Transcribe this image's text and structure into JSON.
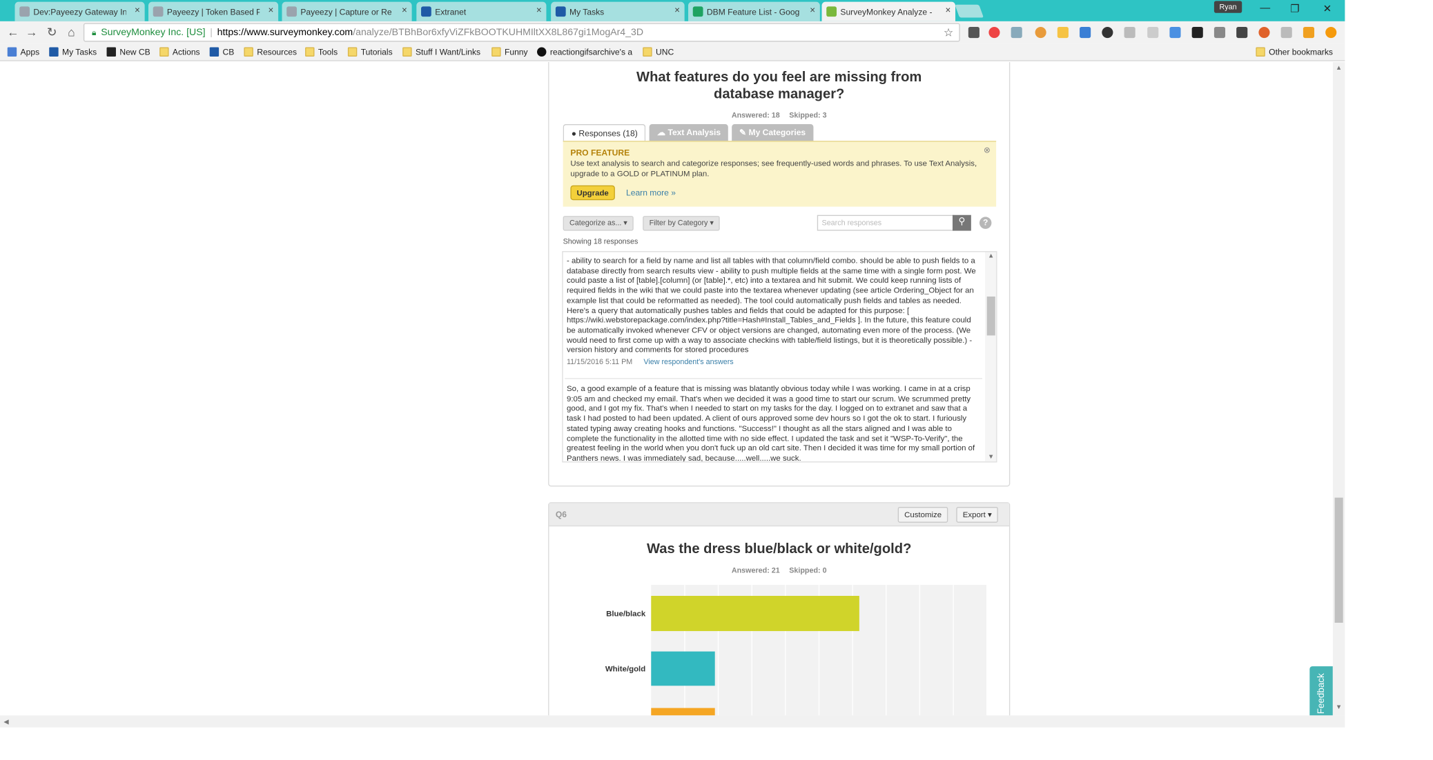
{
  "browser": {
    "tabs": [
      {
        "label": "Dev:Payeezy Gateway Int",
        "favicon_color": "#9aa3ad"
      },
      {
        "label": "Payeezy | Token Based Pa",
        "favicon_color": "#9aa3ad"
      },
      {
        "label": "Payeezy | Capture or Re",
        "favicon_color": "#9aa3ad"
      },
      {
        "label": "Extranet",
        "favicon_color": "#1f5aa6"
      },
      {
        "label": "My Tasks",
        "favicon_color": "#1f5aa6"
      },
      {
        "label": "DBM Feature List - Goog",
        "favicon_color": "#1ea362"
      },
      {
        "label": "SurveyMonkey Analyze -",
        "favicon_color": "#7bb83c"
      }
    ],
    "close_glyph": "×",
    "user_name": "Ryan",
    "window_controls": {
      "minimize": "—",
      "maximize": "❐",
      "close": "✕"
    },
    "nav": {
      "back": "←",
      "forward": "→",
      "reload": "↻",
      "home": "⌂"
    },
    "address": {
      "secure_label": "SurveyMonkey Inc. [US]",
      "url_host": "https://www.surveymonkey.com",
      "url_path": "/analyze/BTBhBor6xfyViZFkBOOTKUHMIltXX8L867gi1MogAr4_3D",
      "star": "☆"
    },
    "bookmarks": [
      {
        "label": "Apps",
        "icon": "apps-grid-icon"
      },
      {
        "label": "My Tasks",
        "icon": "bird-icon"
      },
      {
        "label": "New CB",
        "icon": "cb-icon"
      },
      {
        "label": "Actions",
        "icon": "folder-icon"
      },
      {
        "label": "CB",
        "icon": "bird-icon"
      },
      {
        "label": "Resources",
        "icon": "folder-icon"
      },
      {
        "label": "Tools",
        "icon": "folder-icon"
      },
      {
        "label": "Tutorials",
        "icon": "folder-icon"
      },
      {
        "label": "Stuff I Want/Links",
        "icon": "folder-icon"
      },
      {
        "label": "Funny",
        "icon": "folder-icon"
      },
      {
        "label": "reactiongifsarchive's a",
        "icon": "site-icon"
      },
      {
        "label": "UNC",
        "icon": "folder-icon"
      }
    ],
    "other_bookmarks": "Other bookmarks"
  },
  "q5": {
    "title_line1": "What features do you feel are missing from",
    "title_line2": "database manager?",
    "answered": "Answered: 18",
    "skipped": "Skipped: 3",
    "tabs": {
      "responses": "Responses (18)",
      "text_analysis": "Text Analysis",
      "my_categories": "My Categories"
    },
    "pro": {
      "title": "PRO FEATURE",
      "body": "Use text analysis to search and categorize responses; see frequently-used words and phrases. To use Text Analysis, upgrade to a GOLD or PLATINUM plan.",
      "upgrade": "Upgrade",
      "learn_more": "Learn more »",
      "close": "⊗"
    },
    "filters": {
      "categorize": "Categorize as... ▾",
      "filter": "Filter by Category ▾",
      "search_placeholder": "Search responses",
      "help": "?"
    },
    "showing": "Showing 18 responses",
    "responses": [
      {
        "text": "- ability to search for a field by name and list all tables with that column/field combo. should be able to push fields to a database directly from search results view - ability to push multiple fields at the same time with a single form post. We could paste a list of [table].[column] (or [table].*, etc) into a textarea and hit submit. We could keep running lists of required fields in the wiki that we could paste into the textarea whenever updating (see article Ordering_Object for an example list that could be reformatted as needed). The tool could automatically push fields and tables as needed. Here's a query that automatically pushes tables and fields that could be adapted for this purpose: [ https://wiki.webstorepackage.com/index.php?title=Hash#Install_Tables_and_Fields ]. In the future, this feature could be automatically invoked whenever CFV or object versions are changed, automating even more of the process. (We would need to first come up with a way to associate checkins with table/field listings, but it is theoretically possible.) - version history and comments for stored procedures",
        "date": "11/15/2016 5:11 PM",
        "link": "View respondent's answers"
      },
      {
        "text": "So, a good example of a feature that is missing was blatantly obvious today while I was working. I came in at a crisp 9:05 am and checked my email. That's when we decided it was a good time to start our scrum. We scrummed pretty good, and I got my fix. That's when I needed to start on my tasks for the day. I logged on to extranet and saw that a task I had posted to had been updated. A client of ours approved some dev hours so I got the ok to start. I furiously stated typing away creating hooks and functions. \"Success!\" I thought as all the stars aligned and I was able to complete the functionality in the allotted time with no side effect. I updated the task and set it \"WSP-To-Verify\", the greatest feeling in the world when you don't fuck up an old cart site. Then I decided it was time for my small portion of Panthers news. I was immediately sad, because.....well.....we suck."
      }
    ]
  },
  "q6": {
    "label": "Q6",
    "customize": "Customize",
    "export": "Export ▾",
    "title": "Was the dress blue/black or white/gold?",
    "answered": "Answered: 21",
    "skipped": "Skipped: 0"
  },
  "chart_data": {
    "type": "bar",
    "orientation": "horizontal",
    "categories": [
      "Blue/black",
      "White/gold"
    ],
    "values": [
      62,
      19
    ],
    "unit": "percent",
    "xlim": [
      0,
      100
    ],
    "grid": true,
    "colors": [
      "#d0d42a",
      "#33b9c0",
      "#f5a623"
    ]
  },
  "widgets": {
    "feedback": "Feedback",
    "bug_icon": "✹"
  }
}
